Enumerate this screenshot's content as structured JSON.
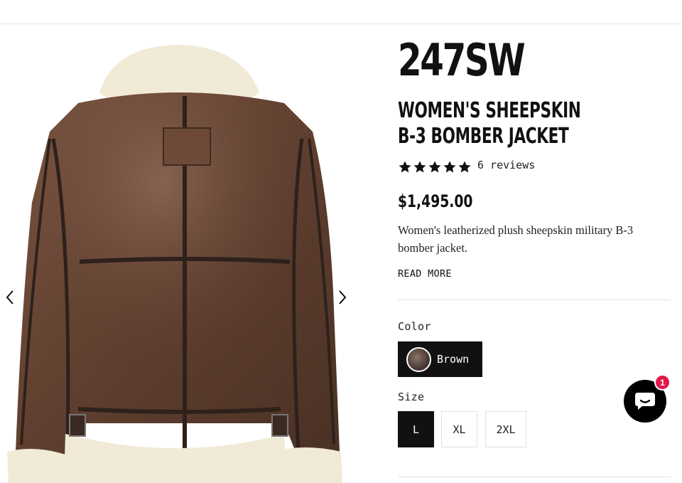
{
  "gallery": {
    "image_alt": "Women's Sheepskin B-3 Bomber Jacket - back view",
    "prev_icon": "chevron-left-icon",
    "next_icon": "chevron-right-icon"
  },
  "product": {
    "brand": "247SW",
    "title_line1": "WOMEN'S SHEEPSKIN",
    "title_line2": "B-3 BOMBER JACKET",
    "rating": 5,
    "reviews_label": "6 reviews",
    "price": "$1,495.00",
    "description": "Women's leatherized plush sheepskin military B-3 bomber jacket.",
    "read_more": "READ MORE"
  },
  "options": {
    "color_label": "Color",
    "color_selected": "Brown",
    "size_label": "Size",
    "sizes": [
      "L",
      "XL",
      "2XL"
    ],
    "size_selected": "L"
  },
  "chat": {
    "icon": "chat-bubble-icon",
    "badge_count": "1"
  },
  "colors": {
    "accent_dark": "#111111",
    "badge": "#e0174a",
    "leather": "#5e3f2e",
    "fleece": "#f1ead6"
  }
}
